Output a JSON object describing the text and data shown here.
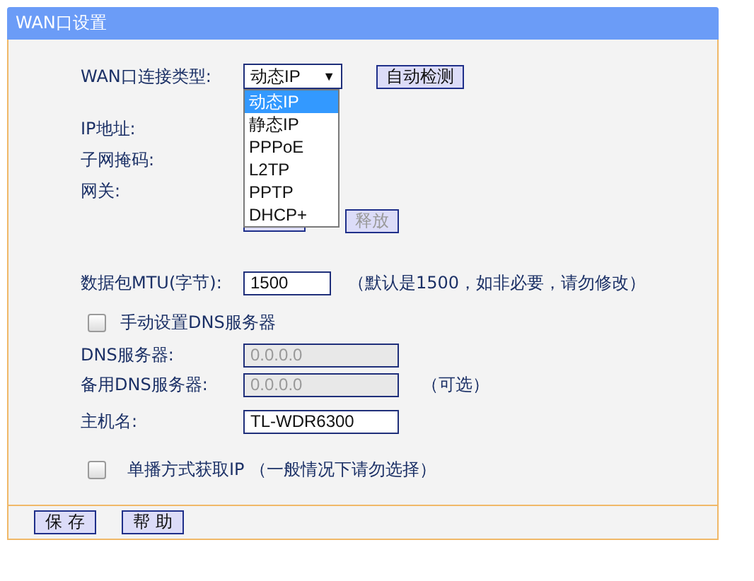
{
  "panel": {
    "title": "WAN口设置"
  },
  "connection_type": {
    "label": "WAN口连接类型:",
    "value": "动态IP",
    "arrow": "▼",
    "expanded": true,
    "options": [
      {
        "label": "动态IP",
        "selected": true
      },
      {
        "label": "静态IP",
        "selected": false
      },
      {
        "label": "PPPoE",
        "selected": false
      },
      {
        "label": "L2TP",
        "selected": false
      },
      {
        "label": "PPTP",
        "selected": false
      },
      {
        "label": "DHCP+",
        "selected": false
      }
    ]
  },
  "detect_button": {
    "label": "自动检测"
  },
  "info_labels": [
    "IP地址:",
    "子网掩码:",
    "网关:"
  ],
  "lease_buttons": [
    {
      "kind": "covered"
    },
    {
      "kind": "labeled",
      "label": "释放",
      "disabled": true
    }
  ],
  "mtu": {
    "label": "数据包MTU(字节):",
    "value": "1500",
    "note": "（默认是1500，如非必要，请勿修改）"
  },
  "manual_dns": {
    "label": "手动设置DNS服务器",
    "checked": false
  },
  "dns_rows": [
    {
      "label": "DNS服务器:",
      "value": "0.0.0.0",
      "disabled": true
    },
    {
      "label": "备用DNS服务器:",
      "value": "0.0.0.0",
      "disabled": true,
      "note": "（可选）"
    }
  ],
  "host": {
    "label": "主机名:",
    "value": "TL-WDR6300",
    "disabled": false
  },
  "unicast": {
    "label": "单播方式获取IP （一般情况下请勿选择）",
    "checked": false
  },
  "footer_buttons": [
    "保存",
    "帮助"
  ]
}
